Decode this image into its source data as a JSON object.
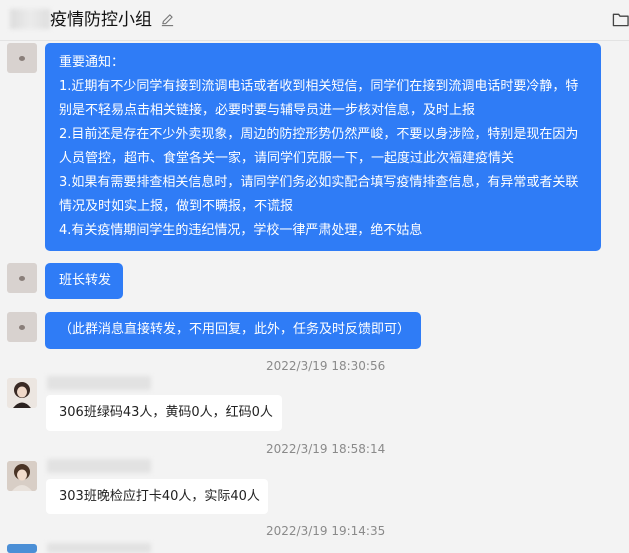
{
  "header": {
    "title": "疫情防控小组",
    "icons": [
      "edit-icon",
      "folder-icon"
    ]
  },
  "messages": {
    "notice": {
      "heading": "重要通知：",
      "items": [
        "1.近期有不少同学有接到流调电话或者收到相关短信，同学们在接到流调电话时要冷静，特别是不轻易点击相关链接，必要时要与辅导员进一步核对信息，及时上报",
        "2.目前还是存在不少外卖现象，周边的防控形势仍然严峻，不要以身涉险，特别是现在因为人员管控，超市、食堂各关一家，请同学们克服一下，一起度过此次福建疫情关",
        "3.如果有需要排查相关信息时，请同学们务必如实配合填写疫情排查信息，有异常或者关联情况及时如实上报，做到不瞒报，不谎报",
        "4.有关疫情期间学生的违纪情况，学校一律严肃处理，绝不姑息"
      ]
    },
    "forward": "班长转发",
    "instruction": "（此群消息直接转发，不用回复，此外，任务及时反馈即可）",
    "time1": "2022/3/19 18:30:56",
    "report1": "306班绿码43人，黄码0人，红码0人",
    "time2": "2022/3/19 18:58:14",
    "report2": "303班晚检应打卡40人，实际40人",
    "time3": "2022/3/19 19:14:35"
  },
  "colors": {
    "accent_bubble": "#2f7cf6",
    "background": "#f3f3f3",
    "timestamp": "#8a8a8a"
  }
}
